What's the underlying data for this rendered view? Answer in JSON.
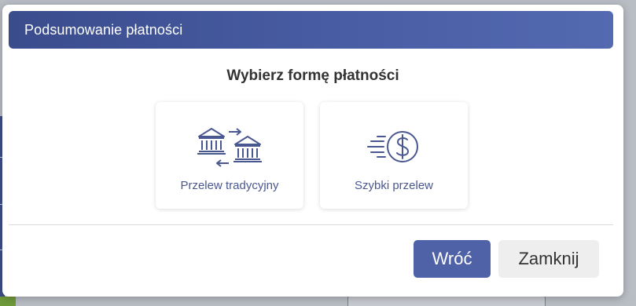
{
  "modal": {
    "title": "Podsumowanie płatności",
    "section_title": "Wybierz formę płatności",
    "options": [
      {
        "label": "Przelew tradycyjny",
        "icon": "bank-transfer-icon"
      },
      {
        "label": "Szybki przelew",
        "icon": "fast-dollar-icon"
      }
    ],
    "buttons": {
      "back_label": "Wróć",
      "close_label": "Zamknij"
    }
  },
  "colors": {
    "header_start": "#3a4c8c",
    "header_end": "#5369b0",
    "primary_button": "#4f62a7",
    "secondary_button": "#eeeeee",
    "icon_color": "#4a5891"
  }
}
